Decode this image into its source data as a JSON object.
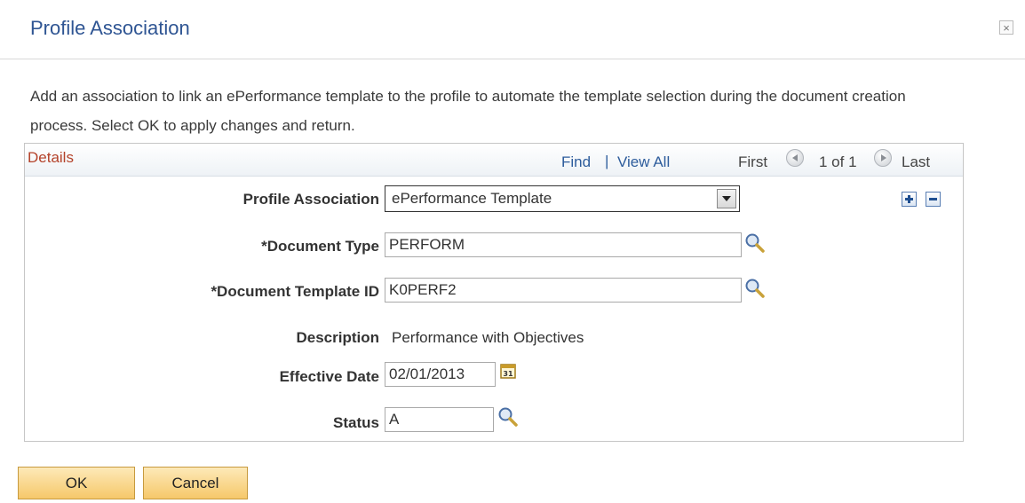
{
  "dialog": {
    "title": "Profile Association",
    "close_glyph": "×",
    "instructions": "Add an association to link an ePerformance template to the profile to automate the template selection during the document creation process.  Select OK to apply changes and return."
  },
  "details": {
    "title": "Details",
    "nav": {
      "find": "Find",
      "separator": "|",
      "view_all": "View All",
      "first": "First",
      "count": "1 of 1",
      "last": "Last"
    },
    "fields": {
      "profile_association": {
        "label": "Profile Association",
        "value": "ePerformance Template"
      },
      "document_type": {
        "label": "*Document Type",
        "value": "PERFORM"
      },
      "document_template_id": {
        "label": "*Document Template ID",
        "value": "K0PERF2"
      },
      "description": {
        "label": "Description",
        "value": "Performance with Objectives"
      },
      "effective_date": {
        "label": "Effective Date",
        "value": "02/01/2013"
      },
      "status": {
        "label": "Status",
        "value": "A"
      }
    },
    "icons": {
      "lookup": "magnifier-icon",
      "calendar": "calendar-icon",
      "add": "plus-icon",
      "delete": "minus-icon"
    }
  },
  "buttons": {
    "ok": "OK",
    "cancel": "Cancel"
  },
  "colors": {
    "title": "#2f5593",
    "link": "#2d5c9c",
    "section_title": "#b4422a",
    "button": "#f6c86a"
  }
}
